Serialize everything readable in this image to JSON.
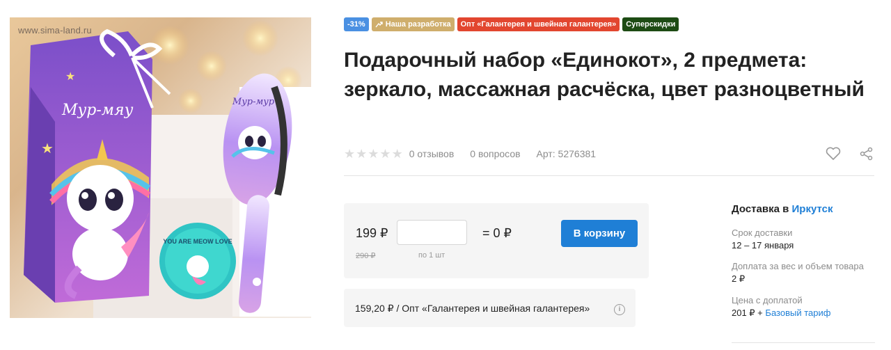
{
  "image": {
    "watermark": "www.sima-land.ru",
    "bag_text": "Мур-мяу",
    "brush_text": "Мур-мур",
    "mirror_text": "YOU ARE MEOW LOVE"
  },
  "badges": {
    "discount": "-31%",
    "own_dev": "Наша разработка",
    "wholesale": "Опт «Галантерея и швейная галантерея»",
    "super": "Суперскидки"
  },
  "title": "Подарочный набор «Единокот», 2 предмета: зеркало, массажная расчёска, цвет разноцветный",
  "meta": {
    "rating": 0,
    "reviews": "0 отзывов",
    "questions": "0 вопросов",
    "article": "Арт: 5276381"
  },
  "price": {
    "current": "199 ₽",
    "old": "290 ₽",
    "qty_value": "",
    "qty_placeholder": "",
    "qty_note": "по 1 шт",
    "total": "= 0 ₽",
    "cart_button": "В корзину"
  },
  "wholesale_offer": "159,20 ₽ / Опт «Галантерея и швейная галантерея»",
  "delivery": {
    "heading": "Доставка в",
    "city": "Иркутск",
    "term_label": "Срок доставки",
    "term_value": "12 – 17 января",
    "extra_label": "Доплата за вес и объем товара",
    "extra_value": "2 ₽",
    "total_label": "Цена с доплатой",
    "total_value": "201 ₽ +",
    "tariff_link": "Базовый тариф"
  },
  "colors": {
    "accent": "#1f7fd6",
    "badge_discount": "#4a90e2",
    "badge_own": "#cfae6c",
    "badge_wholesale": "#e2462f",
    "badge_super": "#1d4b14"
  },
  "icons": [
    "heart-icon",
    "share-icon",
    "info-icon",
    "trend-arrow-icon",
    "star-icon"
  ]
}
